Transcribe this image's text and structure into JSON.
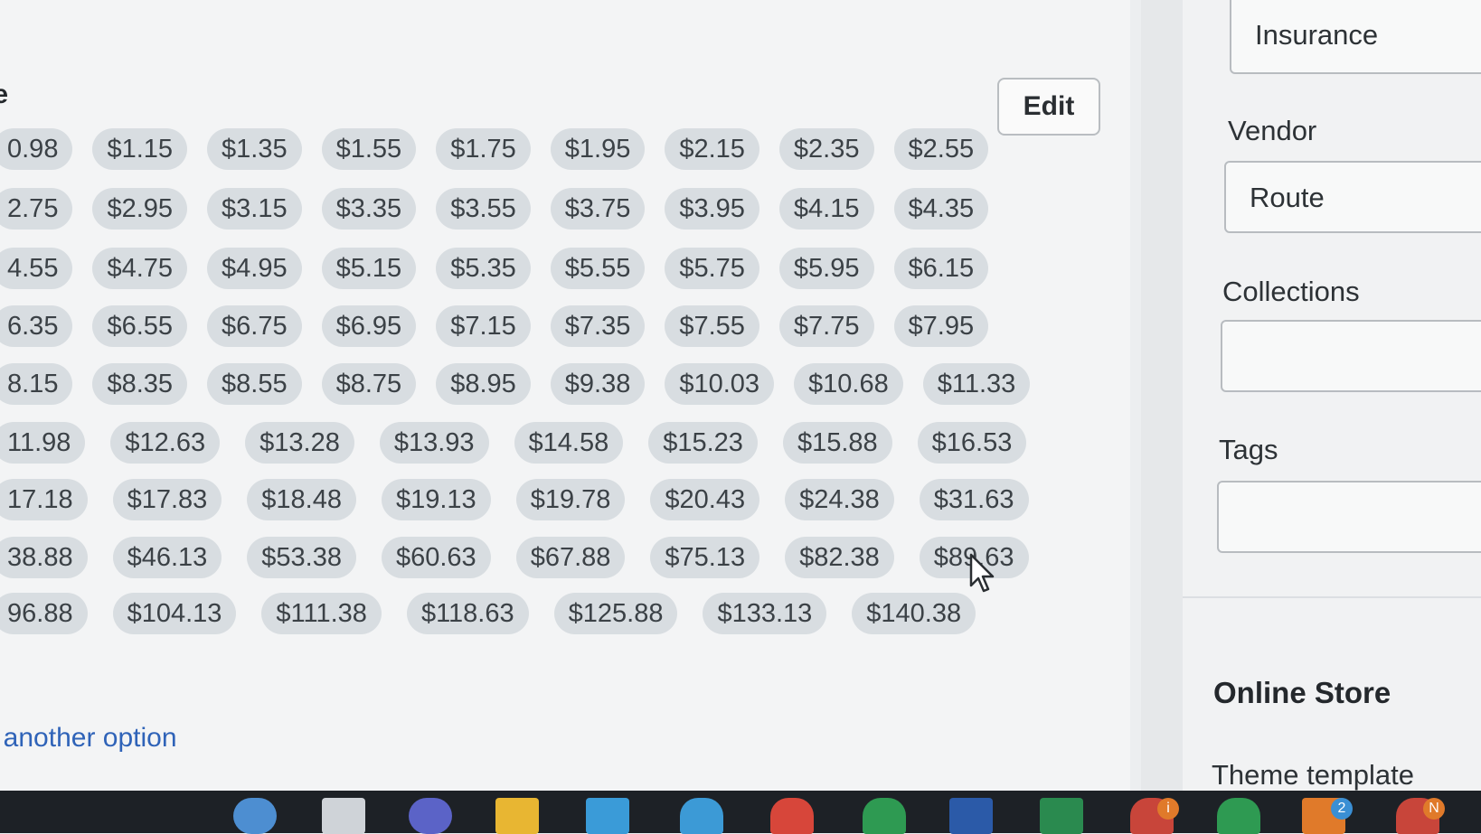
{
  "card": {
    "title": "le",
    "edit_label": "Edit",
    "add_option": "ld another option"
  },
  "chip_rows": [
    [
      "0.98",
      "$1.15",
      "$1.35",
      "$1.55",
      "$1.75",
      "$1.95",
      "$2.15",
      "$2.35",
      "$2.55"
    ],
    [
      "2.75",
      "$2.95",
      "$3.15",
      "$3.35",
      "$3.55",
      "$3.75",
      "$3.95",
      "$4.15",
      "$4.35"
    ],
    [
      "4.55",
      "$4.75",
      "$4.95",
      "$5.15",
      "$5.35",
      "$5.55",
      "$5.75",
      "$5.95",
      "$6.15"
    ],
    [
      "6.35",
      "$6.55",
      "$6.75",
      "$6.95",
      "$7.15",
      "$7.35",
      "$7.55",
      "$7.75",
      "$7.95"
    ],
    [
      "8.15",
      "$8.35",
      "$8.55",
      "$8.75",
      "$8.95",
      "$9.38",
      "$10.03",
      "$10.68",
      "$11.33"
    ],
    [
      "11.98",
      "$12.63",
      "$13.28",
      "$13.93",
      "$14.58",
      "$15.23",
      "$15.88",
      "$16.53"
    ],
    [
      "17.18",
      "$17.83",
      "$18.48",
      "$19.13",
      "$19.78",
      "$20.43",
      "$24.38",
      "$31.63"
    ],
    [
      "38.88",
      "$46.13",
      "$53.38",
      "$60.63",
      "$67.88",
      "$75.13",
      "$82.38",
      "$89.63"
    ],
    [
      "96.88",
      "$104.13",
      "$111.38",
      "$118.63",
      "$125.88",
      "$133.13",
      "$140.38"
    ]
  ],
  "sidebar": {
    "product_type_value": "Insurance",
    "vendor_label": "Vendor",
    "vendor_value": "Route",
    "collections_label": "Collections",
    "collections_value": "",
    "tags_label": "Tags",
    "tags_value": "",
    "online_store_heading": "Online Store",
    "theme_template_label": "Theme template"
  },
  "taskbar": {
    "icons": [
      "globe-icon",
      "monitor-icon",
      "browser-icon",
      "folder-icon",
      "store-icon",
      "edge-icon",
      "chrome-icon",
      "app-icon",
      "word-icon",
      "excel-icon",
      "chrome-profile-icon",
      "app-icon-2",
      "chrome-profile-icon-2",
      "chrome-profile-icon-3"
    ],
    "badges": [
      "i",
      "2",
      "N"
    ]
  }
}
